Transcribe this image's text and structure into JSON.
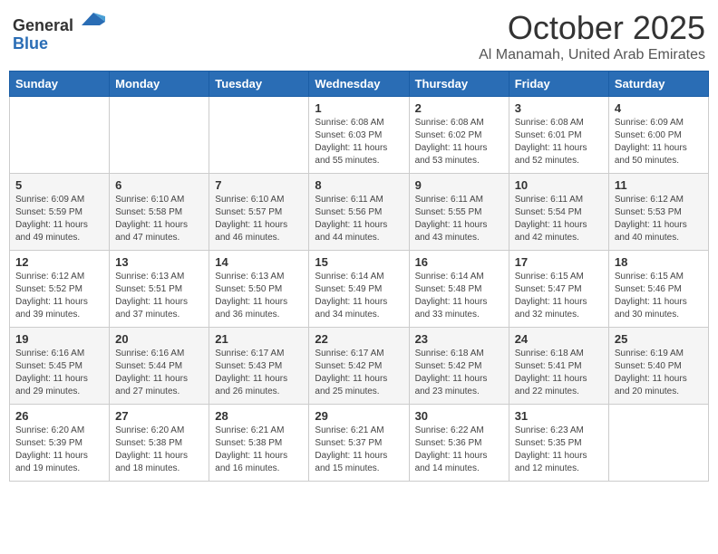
{
  "header": {
    "logo_general": "General",
    "logo_blue": "Blue",
    "month_title": "October 2025",
    "subtitle": "Al Manamah, United Arab Emirates"
  },
  "weekdays": [
    "Sunday",
    "Monday",
    "Tuesday",
    "Wednesday",
    "Thursday",
    "Friday",
    "Saturday"
  ],
  "weeks": [
    [
      {
        "day": "",
        "info": ""
      },
      {
        "day": "",
        "info": ""
      },
      {
        "day": "",
        "info": ""
      },
      {
        "day": "1",
        "info": "Sunrise: 6:08 AM\nSunset: 6:03 PM\nDaylight: 11 hours\nand 55 minutes."
      },
      {
        "day": "2",
        "info": "Sunrise: 6:08 AM\nSunset: 6:02 PM\nDaylight: 11 hours\nand 53 minutes."
      },
      {
        "day": "3",
        "info": "Sunrise: 6:08 AM\nSunset: 6:01 PM\nDaylight: 11 hours\nand 52 minutes."
      },
      {
        "day": "4",
        "info": "Sunrise: 6:09 AM\nSunset: 6:00 PM\nDaylight: 11 hours\nand 50 minutes."
      }
    ],
    [
      {
        "day": "5",
        "info": "Sunrise: 6:09 AM\nSunset: 5:59 PM\nDaylight: 11 hours\nand 49 minutes."
      },
      {
        "day": "6",
        "info": "Sunrise: 6:10 AM\nSunset: 5:58 PM\nDaylight: 11 hours\nand 47 minutes."
      },
      {
        "day": "7",
        "info": "Sunrise: 6:10 AM\nSunset: 5:57 PM\nDaylight: 11 hours\nand 46 minutes."
      },
      {
        "day": "8",
        "info": "Sunrise: 6:11 AM\nSunset: 5:56 PM\nDaylight: 11 hours\nand 44 minutes."
      },
      {
        "day": "9",
        "info": "Sunrise: 6:11 AM\nSunset: 5:55 PM\nDaylight: 11 hours\nand 43 minutes."
      },
      {
        "day": "10",
        "info": "Sunrise: 6:11 AM\nSunset: 5:54 PM\nDaylight: 11 hours\nand 42 minutes."
      },
      {
        "day": "11",
        "info": "Sunrise: 6:12 AM\nSunset: 5:53 PM\nDaylight: 11 hours\nand 40 minutes."
      }
    ],
    [
      {
        "day": "12",
        "info": "Sunrise: 6:12 AM\nSunset: 5:52 PM\nDaylight: 11 hours\nand 39 minutes."
      },
      {
        "day": "13",
        "info": "Sunrise: 6:13 AM\nSunset: 5:51 PM\nDaylight: 11 hours\nand 37 minutes."
      },
      {
        "day": "14",
        "info": "Sunrise: 6:13 AM\nSunset: 5:50 PM\nDaylight: 11 hours\nand 36 minutes."
      },
      {
        "day": "15",
        "info": "Sunrise: 6:14 AM\nSunset: 5:49 PM\nDaylight: 11 hours\nand 34 minutes."
      },
      {
        "day": "16",
        "info": "Sunrise: 6:14 AM\nSunset: 5:48 PM\nDaylight: 11 hours\nand 33 minutes."
      },
      {
        "day": "17",
        "info": "Sunrise: 6:15 AM\nSunset: 5:47 PM\nDaylight: 11 hours\nand 32 minutes."
      },
      {
        "day": "18",
        "info": "Sunrise: 6:15 AM\nSunset: 5:46 PM\nDaylight: 11 hours\nand 30 minutes."
      }
    ],
    [
      {
        "day": "19",
        "info": "Sunrise: 6:16 AM\nSunset: 5:45 PM\nDaylight: 11 hours\nand 29 minutes."
      },
      {
        "day": "20",
        "info": "Sunrise: 6:16 AM\nSunset: 5:44 PM\nDaylight: 11 hours\nand 27 minutes."
      },
      {
        "day": "21",
        "info": "Sunrise: 6:17 AM\nSunset: 5:43 PM\nDaylight: 11 hours\nand 26 minutes."
      },
      {
        "day": "22",
        "info": "Sunrise: 6:17 AM\nSunset: 5:42 PM\nDaylight: 11 hours\nand 25 minutes."
      },
      {
        "day": "23",
        "info": "Sunrise: 6:18 AM\nSunset: 5:42 PM\nDaylight: 11 hours\nand 23 minutes."
      },
      {
        "day": "24",
        "info": "Sunrise: 6:18 AM\nSunset: 5:41 PM\nDaylight: 11 hours\nand 22 minutes."
      },
      {
        "day": "25",
        "info": "Sunrise: 6:19 AM\nSunset: 5:40 PM\nDaylight: 11 hours\nand 20 minutes."
      }
    ],
    [
      {
        "day": "26",
        "info": "Sunrise: 6:20 AM\nSunset: 5:39 PM\nDaylight: 11 hours\nand 19 minutes."
      },
      {
        "day": "27",
        "info": "Sunrise: 6:20 AM\nSunset: 5:38 PM\nDaylight: 11 hours\nand 18 minutes."
      },
      {
        "day": "28",
        "info": "Sunrise: 6:21 AM\nSunset: 5:38 PM\nDaylight: 11 hours\nand 16 minutes."
      },
      {
        "day": "29",
        "info": "Sunrise: 6:21 AM\nSunset: 5:37 PM\nDaylight: 11 hours\nand 15 minutes."
      },
      {
        "day": "30",
        "info": "Sunrise: 6:22 AM\nSunset: 5:36 PM\nDaylight: 11 hours\nand 14 minutes."
      },
      {
        "day": "31",
        "info": "Sunrise: 6:23 AM\nSunset: 5:35 PM\nDaylight: 11 hours\nand 12 minutes."
      },
      {
        "day": "",
        "info": ""
      }
    ]
  ]
}
